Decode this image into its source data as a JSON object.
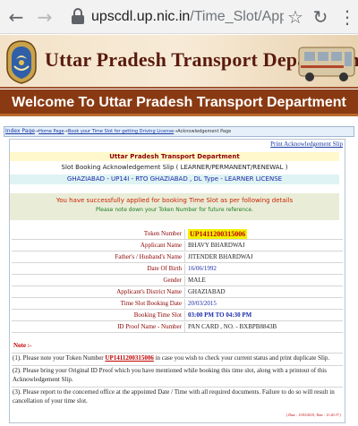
{
  "browser": {
    "url_host": "upscdl.up.nic.in",
    "url_path": "/Time_Slot/Appl"
  },
  "header": {
    "title": "Uttar Pradesh Transport Department",
    "welcome": "Welcome To Uttar Pradesh Transport Department"
  },
  "breadcrumb": {
    "index": "Index Page",
    "home": "Home Page",
    "book": "Book your Time Slot for getting Driving License",
    "current": "Acknowledgement Page",
    "sep": "→"
  },
  "print_link": "Print Acknowledgement Slip",
  "slip": {
    "dept": "Uttar Pradesh Transport Department",
    "title": "Slot Booking Acknowledgement Slip ( LEARNER/PERMANENT/RENEWAL )",
    "office": "GHAZIABAD - UP14I - RTO GHAZIABAD , DL Type - LEARNER LICENSE",
    "success": "You have successfully applied for booking Time Slot as per following details",
    "note_token": "Please note down your Token Number for future reference."
  },
  "fields": [
    {
      "label": "Token Number",
      "value": "UP1411200315006",
      "style": "token"
    },
    {
      "label": "Applicant Name",
      "value": "BHAVY BHARDWAJ",
      "style": ""
    },
    {
      "label": "Father's / Husband's Name",
      "value": "JITENDER BHARDWAJ",
      "style": ""
    },
    {
      "label": "Date Of Birth",
      "value": "16/06/1992",
      "style": "blue"
    },
    {
      "label": "Gender",
      "value": "MALE",
      "style": ""
    },
    {
      "label": "Applicant's District Name",
      "value": "GHAZIABAD",
      "style": ""
    },
    {
      "label": "Time Slot Booking Date",
      "value": "20/03/2015",
      "style": "blue"
    },
    {
      "label": "Booking Time Slot",
      "value": "03:00 PM TO 04:30 PM",
      "style": "blue bold"
    },
    {
      "label": "ID Proof Name - Number",
      "value": "PAN CARD , NO. - BXBPB8843B",
      "style": ""
    }
  ],
  "notes": {
    "heading": "Note :-",
    "n1_pre": "(1). Please note your Token Number",
    "n1_token": "UP1411200315006",
    "n1_post": "in case you wish to check your current status and print duplicate Slip.",
    "n2": "(2). Please bring your Original ID Proof which you have mentioned while booking this time slot, along with a printout of this Acknowledgement Slip.",
    "n3": "(3). Please report to the concerned office at the appointed Date / Time with all required documents. Failure to do so will result in cancellation of your time slot.",
    "footer_date": "( Date : 11/03/2015, Time : 11:20:37 )"
  }
}
